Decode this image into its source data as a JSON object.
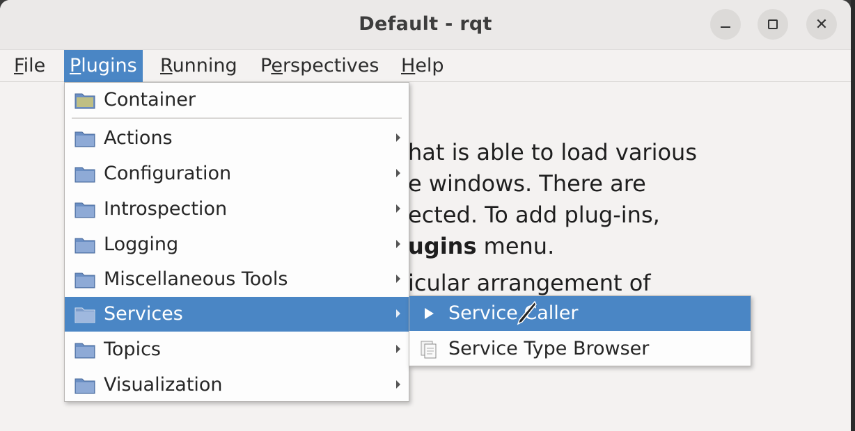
{
  "window": {
    "title": "Default - rqt"
  },
  "menubar": {
    "items": [
      {
        "label": "File",
        "mnemonic": "F",
        "rest": "ile"
      },
      {
        "label": "Plugins",
        "mnemonic": "P",
        "rest": "lugins"
      },
      {
        "label": "Running",
        "mnemonic": "R",
        "rest": "unning"
      },
      {
        "label": "Perspectives",
        "pre": "P",
        "mnemonic": "e",
        "rest": "rspectives"
      },
      {
        "label": "Help",
        "mnemonic": "H",
        "rest": "elp"
      }
    ]
  },
  "plugins_menu": {
    "items": [
      {
        "label": "Container"
      },
      {
        "label": "Actions"
      },
      {
        "label": "Configuration"
      },
      {
        "label": "Introspection"
      },
      {
        "label": "Logging"
      },
      {
        "label": "Miscellaneous Tools"
      },
      {
        "label": "Services"
      },
      {
        "label": "Topics"
      },
      {
        "label": "Visualization"
      }
    ]
  },
  "services_submenu": {
    "items": [
      {
        "label": "Service Caller"
      },
      {
        "label": "Service Type Browser"
      }
    ]
  },
  "background_text": {
    "line1": "hat is able to load various",
    "line2": "e windows. There are",
    "line3": "ected. To add plug-ins,",
    "line4_bold": "ugins",
    "line4_rest": " menu.",
    "line5": "icular arrangement of"
  },
  "colors": {
    "selection": "#4a86c5",
    "folder": "#6b8fc4"
  }
}
